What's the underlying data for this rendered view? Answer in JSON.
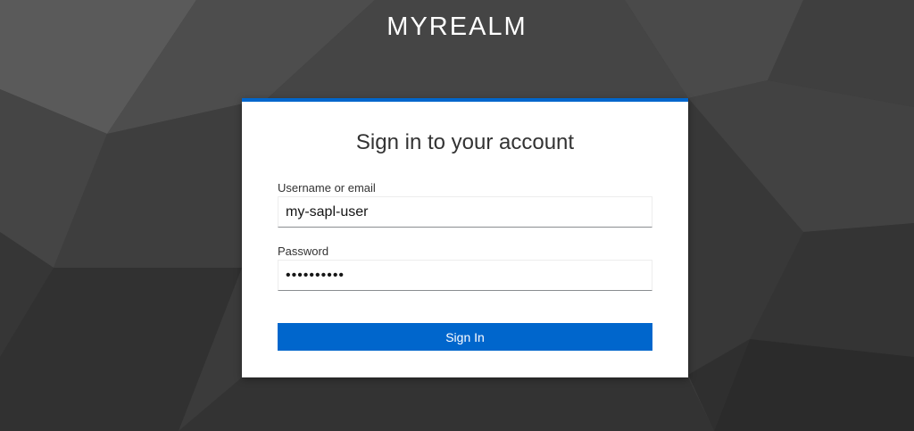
{
  "realm": {
    "title": "MYREALM"
  },
  "login": {
    "heading": "Sign in to your account",
    "username_label": "Username or email",
    "username_value": "my-sapl-user",
    "password_label": "Password",
    "password_value": "••••••••••",
    "submit_label": "Sign In"
  },
  "colors": {
    "accent": "#0066cc",
    "background": "#3a3a3a",
    "card": "#ffffff"
  }
}
